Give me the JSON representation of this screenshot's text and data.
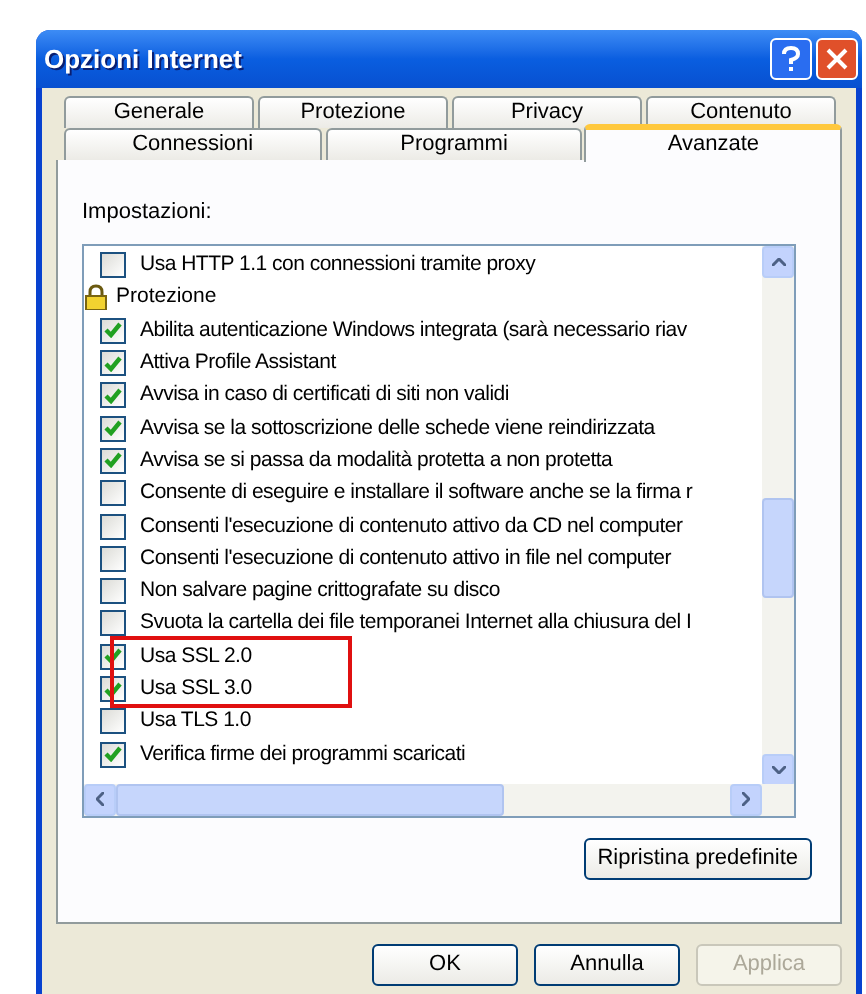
{
  "window": {
    "title": "Opzioni Internet"
  },
  "tabs": [
    [
      {
        "label": "Generale",
        "selected": false
      },
      {
        "label": "Protezione",
        "selected": false
      },
      {
        "label": "Privacy",
        "selected": false
      },
      {
        "label": "Contenuto",
        "selected": false
      }
    ],
    [
      {
        "label": "Connessioni",
        "selected": false
      },
      {
        "label": "Programmi",
        "selected": false
      },
      {
        "label": "Avanzate",
        "selected": true
      }
    ]
  ],
  "settings_label": "Impostazioni:",
  "settings": [
    {
      "kind": "checkbox",
      "label": "Usa HTTP 1.1 con connessioni tramite proxy",
      "checked": false
    },
    {
      "kind": "group",
      "label": "Protezione"
    },
    {
      "kind": "checkbox",
      "label": "Abilita autenticazione Windows integrata (sarà necessario riav",
      "checked": true
    },
    {
      "kind": "checkbox",
      "label": "Attiva Profile Assistant",
      "checked": true
    },
    {
      "kind": "checkbox",
      "label": "Avvisa in caso di certificati di siti non validi",
      "checked": true
    },
    {
      "kind": "checkbox",
      "label": "Avvisa se la sottoscrizione delle schede viene reindirizzata",
      "checked": true
    },
    {
      "kind": "checkbox",
      "label": "Avvisa se si passa da modalità protetta a non protetta",
      "checked": true
    },
    {
      "kind": "checkbox",
      "label": "Consente di eseguire e installare il software anche se la firma r",
      "checked": false
    },
    {
      "kind": "checkbox",
      "label": "Consenti l'esecuzione di contenuto attivo da CD nel computer",
      "checked": false
    },
    {
      "kind": "checkbox",
      "label": "Consenti l'esecuzione di contenuto attivo in file nel computer",
      "checked": false
    },
    {
      "kind": "checkbox",
      "label": "Non salvare pagine crittografate su disco",
      "checked": false
    },
    {
      "kind": "checkbox",
      "label": "Svuota la cartella dei file temporanei Internet alla chiusura del I",
      "checked": false
    },
    {
      "kind": "checkbox",
      "label": "Usa SSL 2.0",
      "checked": true
    },
    {
      "kind": "checkbox",
      "label": "Usa SSL 3.0",
      "checked": true
    },
    {
      "kind": "checkbox",
      "label": "Usa TLS 1.0",
      "checked": false
    },
    {
      "kind": "checkbox",
      "label": "Verifica firme dei programmi scaricati",
      "checked": true
    }
  ],
  "restore_button": "Ripristina predefinite",
  "buttons": [
    {
      "label": "OK",
      "disabled": false
    },
    {
      "label": "Annulla",
      "disabled": false
    },
    {
      "label": "Applica",
      "disabled": true
    }
  ]
}
